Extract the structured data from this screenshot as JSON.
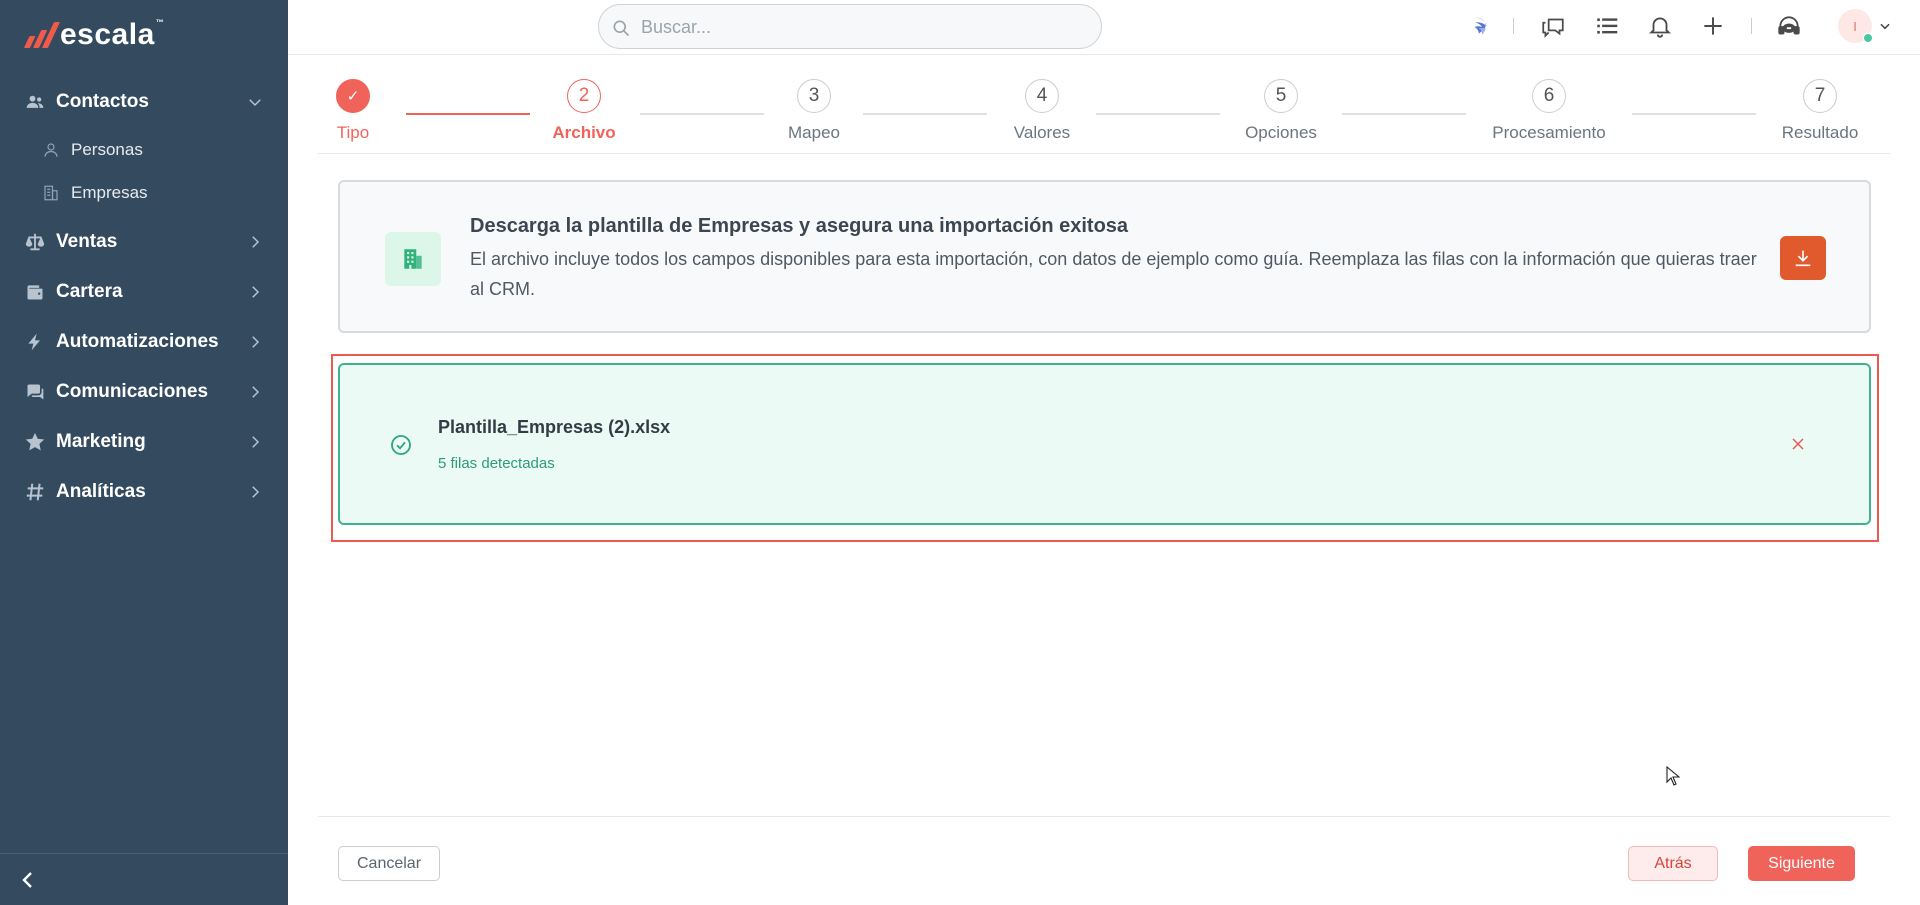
{
  "brand": {
    "name": "escala",
    "tm": "™",
    "accent": "#f05a4a"
  },
  "sidebar": {
    "background": "#344a5f",
    "items": [
      {
        "label": "Contactos",
        "icon": "users-icon",
        "expanded": true,
        "children": [
          {
            "label": "Personas",
            "icon": "person-icon"
          },
          {
            "label": "Empresas",
            "icon": "building-icon"
          }
        ]
      },
      {
        "label": "Ventas",
        "icon": "scale-icon"
      },
      {
        "label": "Cartera",
        "icon": "wallet-icon"
      },
      {
        "label": "Automatizaciones",
        "icon": "lightning-icon"
      },
      {
        "label": "Comunicaciones",
        "icon": "chat-icon"
      },
      {
        "label": "Marketing",
        "icon": "star-icon"
      },
      {
        "label": "Analíticas",
        "icon": "hash-icon"
      }
    ]
  },
  "topbar": {
    "search_placeholder": "Buscar...",
    "avatar_initial": "I"
  },
  "stepper": {
    "steps": [
      {
        "number": "✓",
        "label": "Tipo",
        "state": "done"
      },
      {
        "number": "2",
        "label": "Archivo",
        "state": "active"
      },
      {
        "number": "3",
        "label": "Mapeo",
        "state": "pending"
      },
      {
        "number": "4",
        "label": "Valores",
        "state": "pending"
      },
      {
        "number": "5",
        "label": "Opciones",
        "state": "pending"
      },
      {
        "number": "6",
        "label": "Procesamiento",
        "state": "pending"
      },
      {
        "number": "7",
        "label": "Resultado",
        "state": "pending"
      }
    ]
  },
  "template": {
    "title": "Descarga la plantilla de Empresas y asegura una importación exitosa",
    "description": "El archivo incluye todos los campos disponibles para esta importación, con datos de ejemplo como guía. Reemplaza las filas con la información que quieras traer al CRM."
  },
  "upload": {
    "file_name": "Plantilla_Empresas (2).xlsx",
    "rows_detected": "5 filas detectadas",
    "status_color": "#3eb48e"
  },
  "footer": {
    "cancel_label": "Cancelar",
    "back_label": "Atrás",
    "next_label": "Siguiente"
  }
}
